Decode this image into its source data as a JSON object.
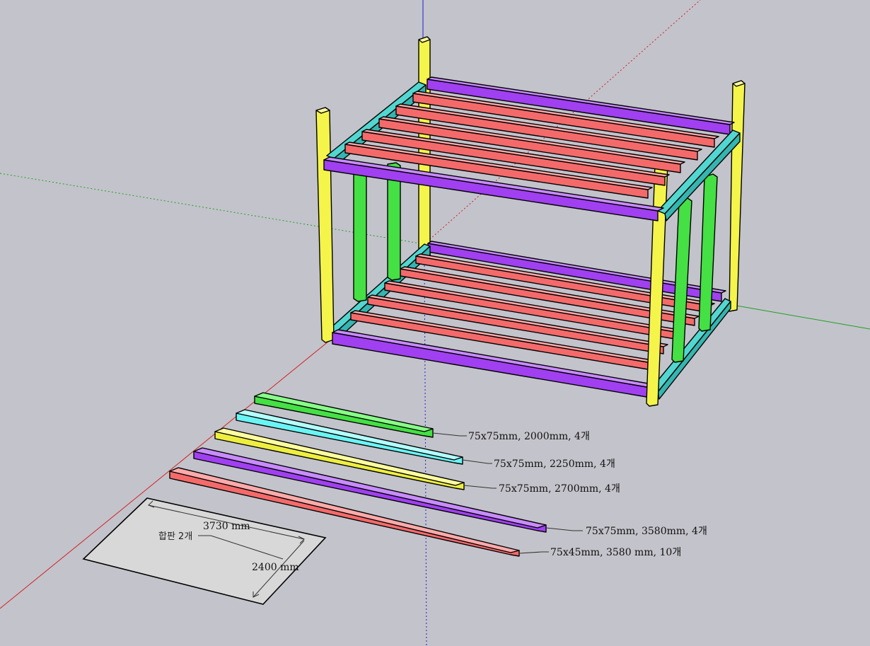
{
  "colors": {
    "background": "#c3c3cb",
    "post_yellow": "#f4f44a",
    "stud_green": "#44e044",
    "rail_cyan": "#52d6d0",
    "beam_purple": "#a040f0",
    "joist_red": "#f46a6a",
    "cyan_piece": "#6af4f4",
    "yellow_piece": "#eeee40",
    "axis_red": "#d02020",
    "axis_green": "#20a020",
    "axis_blue": "#2020d0"
  },
  "parts": [
    {
      "color": "green",
      "label": "75x75mm, 2000mm, 4개"
    },
    {
      "color": "cyan",
      "label": "75x75mm, 2250mm, 4개"
    },
    {
      "color": "yellow",
      "label": "75x75mm, 2700mm, 4개"
    },
    {
      "color": "purple",
      "label": "75x75mm, 3580mm, 4개"
    },
    {
      "color": "red",
      "label": "75x45mm, 3580 mm, 10개"
    }
  ],
  "plywood": {
    "label": "합판 2개",
    "width_dim": "3730 mm",
    "height_dim": "2400 mm"
  },
  "icons": [
    "axis-lines"
  ]
}
